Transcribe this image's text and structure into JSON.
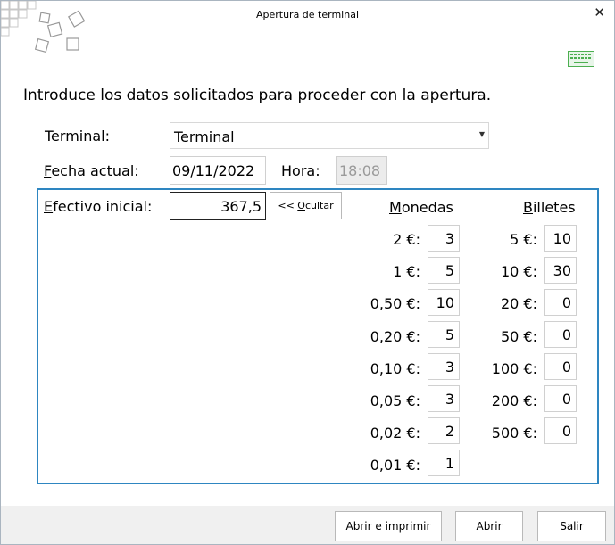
{
  "window": {
    "title": "Apertura de terminal",
    "close_glyph": "✕"
  },
  "intro": "Introduce los datos solicitados para proceder con la apertura.",
  "terminal": {
    "label": "Terminal:",
    "value": "Terminal"
  },
  "fecha": {
    "label_first": "F",
    "label_rest": "echa actual:",
    "value": "09/11/2022"
  },
  "hora": {
    "label": "Hora:",
    "value": "18:08"
  },
  "efectivo": {
    "label_first": "E",
    "label_rest": "fectivo inicial:",
    "value": "367,5"
  },
  "ocultar": {
    "prefix": "<< ",
    "first": "O",
    "rest": "cultar"
  },
  "monedas": {
    "header_first": "M",
    "header_rest": "onedas",
    "rows": [
      {
        "den": "2 €:",
        "qty": "3"
      },
      {
        "den": "1 €:",
        "qty": "5"
      },
      {
        "den": "0,50 €:",
        "qty": "10"
      },
      {
        "den": "0,20 €:",
        "qty": "5"
      },
      {
        "den": "0,10 €:",
        "qty": "3"
      },
      {
        "den": "0,05 €:",
        "qty": "3"
      },
      {
        "den": "0,02 €:",
        "qty": "2"
      },
      {
        "den": "0,01 €:",
        "qty": "1"
      }
    ]
  },
  "billetes": {
    "header_first": "B",
    "header_rest": "illetes",
    "rows": [
      {
        "den": "5 €:",
        "qty": "10"
      },
      {
        "den": "10 €:",
        "qty": "30"
      },
      {
        "den": "20 €:",
        "qty": "0"
      },
      {
        "den": "50 €:",
        "qty": "0"
      },
      {
        "den": "100 €:",
        "qty": "0"
      },
      {
        "den": "200 €:",
        "qty": "0"
      },
      {
        "den": "500 €:",
        "qty": "0"
      }
    ]
  },
  "buttons": {
    "abrir_imprimir": "Abrir e imprimir",
    "abrir": "Abrir",
    "salir": "Salir"
  },
  "colors": {
    "panel_border": "#2e86c1",
    "keyboard_icon": "#4caf50"
  }
}
